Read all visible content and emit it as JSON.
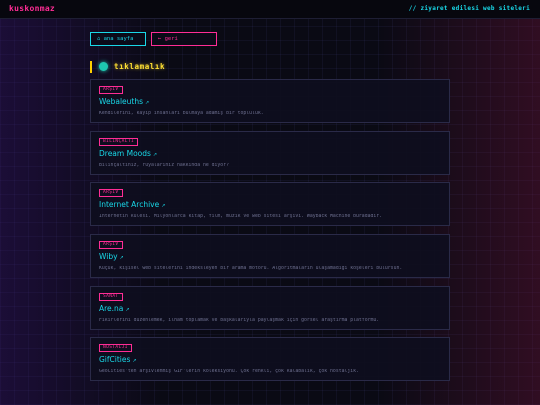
{
  "header": {
    "brand": "kuskonmaz",
    "right_text": "// ziyaret edilesi web siteleri"
  },
  "nav": {
    "home_label": "⌂ ana sayfa",
    "back_label": "← geri"
  },
  "section": {
    "title": "tıklamalık"
  },
  "cards": [
    {
      "tag": "ARŞİV",
      "title": "Webaleuths",
      "desc": "Kendilerini, kayıp insanları bulmaya adamış bir topluluk."
    },
    {
      "tag": "BİLİNÇALTI",
      "title": "Dream Moods",
      "desc": "Bilinçaltınız, rüyalarınız hakkında ne diyor?"
    },
    {
      "tag": "ARŞİV",
      "title": "Internet Archive",
      "desc": "İnternetin kulesi. Milyonlarca kitap, film, müzik ve web sitesi arşivi. Wayback Machine buradadır."
    },
    {
      "tag": "ARŞİV",
      "title": "Wiby",
      "desc": "Küçük, kişisel web sitelerini indeksleyen bir arama motoru. Algoritmaların ulaşamadığı köşeleri bulursun."
    },
    {
      "tag": "SANAT",
      "title": "Are.na",
      "desc": "Fikirlerini düzenlemek, ilham toplamak ve başkalarıyla paylaşmak için görsel araştırma platformu."
    },
    {
      "tag": "NOSTALJİ",
      "title": "GifCities",
      "desc": "GeoCities'ten arşivlenmiş GIF'lerin koleksiyonu. Çok renkli, çok kalabalık, çok nostaljik."
    }
  ],
  "colors": {
    "accent_pink": "#ff2d95",
    "accent_cyan": "#19d8e8",
    "accent_yellow": "#ffe033"
  }
}
